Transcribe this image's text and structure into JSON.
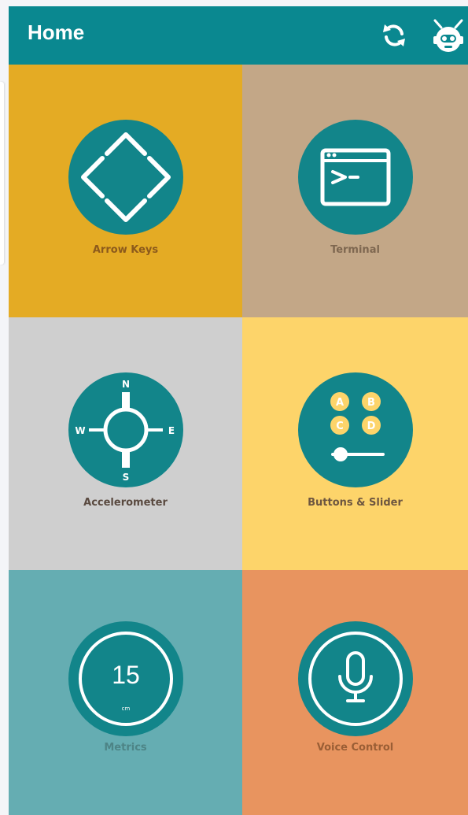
{
  "appbar": {
    "title": "Home",
    "sync_icon": "sync-icon",
    "robot_icon": "robot-settings-icon"
  },
  "tiles": [
    {
      "label": "Arrow Keys",
      "icon": "arrow-keys-icon",
      "color": "#e4ab24"
    },
    {
      "label": "Terminal",
      "icon": "terminal-icon",
      "color": "#c3a787"
    },
    {
      "label": "Accelerometer",
      "icon": "compass-icon",
      "color": "#cfcfcf"
    },
    {
      "label": "Buttons & Slider",
      "icon": "buttons-slider-icon",
      "color": "#fdd46a"
    },
    {
      "label": "Metrics",
      "icon": "metrics-gauge-icon",
      "color": "#65adb2"
    },
    {
      "label": "Voice Control",
      "icon": "microphone-icon",
      "color": "#e8945f"
    }
  ],
  "icon_text": {
    "compass_n": "N",
    "compass_s": "S",
    "compass_w": "W",
    "compass_e": "E",
    "button_a": "A",
    "button_b": "B",
    "button_c": "C",
    "button_d": "D",
    "metric_value": "15",
    "metric_unit": "cm"
  },
  "colors": {
    "primary": "#0a8890",
    "icon_circle": "#12858a"
  }
}
